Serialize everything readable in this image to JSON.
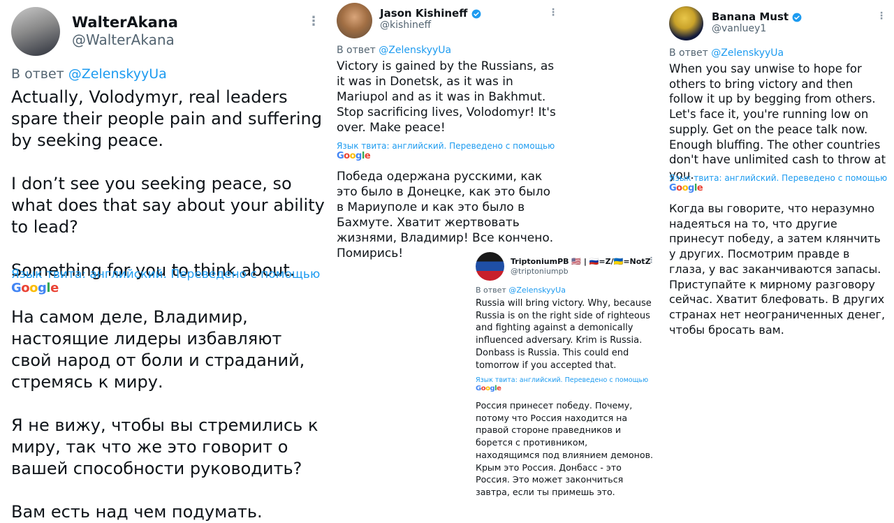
{
  "reply_prefix": "В ответ",
  "translation_note": "Язык твита: английский. Переведено с помощью",
  "google_logo": [
    "G",
    "o",
    "o",
    "g",
    "l",
    "e"
  ],
  "colors": {
    "mention": "#1d9bf0",
    "verified": "#1d9bf0",
    "secondary_text": "#536471"
  },
  "tweets": [
    {
      "name": "WalterAkana",
      "handle": "@WalterAkana",
      "verified": false,
      "reply_to": "@ZelenskyyUa",
      "text_en": [
        "Actually, Volodymyr, real leaders spare their people pain and suffering by seeking peace.",
        "I don’t see you seeking peace, so what does that say about your ability to lead?",
        "Something for you to think about."
      ],
      "text_ru": [
        "На самом деле, Владимир, настоящие лидеры избавляют свой народ от боли и страданий, стремясь к миру.",
        "Я не вижу, чтобы вы стремились к миру, так что же это говорит о вашей способности руководить?",
        "Вам есть над чем подумать."
      ]
    },
    {
      "name": "Jason Kishineff",
      "handle": "@kishineff",
      "verified": true,
      "reply_to": "@ZelenskyyUa",
      "text_en": "Victory is gained by the Russians, as it was in Donetsk, as it was in Mariupol and as it was in Bakhmut. Stop sacrificing lives, Volodomyr! It's over. Make peace!",
      "text_ru": "Победа одержана русскими, как это было в Донецке, как это было в Мариуполе и как это было в Бахмуте. Хватит жертвовать жизнями, Владимир! Все кончено. Помирись!"
    },
    {
      "name": "TriptoniumPB 🇺🇸 | 🇷🇺=Z/🇺🇦=NotZ",
      "handle": "@triptoniumpb",
      "verified": false,
      "reply_to": "@ZelenskyyUa",
      "text_en": "Russia will bring victory. Why, because Russia is on the right side of righteous and fighting against a demonically influenced adversary. Krim is Russia. Donbass is Russia. This could end tomorrow if you accepted that.",
      "text_ru": "Россия принесет победу. Почему, потому что Россия находится на правой стороне праведников и борется с противником, находящимся под влиянием демонов. Крым это Россия. Донбасс - это Россия. Это может закончиться завтра, если ты примешь это."
    },
    {
      "name": "Banana Must",
      "handle": "@vanluey1",
      "verified": true,
      "reply_to": "@ZelenskyyUa",
      "text_en": "When you say unwise to hope for others to bring victory and then follow it up by begging from others. Let's face it, you're running low on supply. Get on the peace talk now. Enough bluffing. The other countries don't have unlimited cash to throw at you.",
      "text_ru": "Когда вы говорите, что неразумно надеяться на то, что другие принесут победу, а затем клянчить у других. Посмотрим правде в глаза, у вас заканчиваются запасы. Приступайте к мирному разговору сейчас. Хватит блефовать. В других странах нет неограниченных денег, чтобы бросать вам."
    }
  ]
}
